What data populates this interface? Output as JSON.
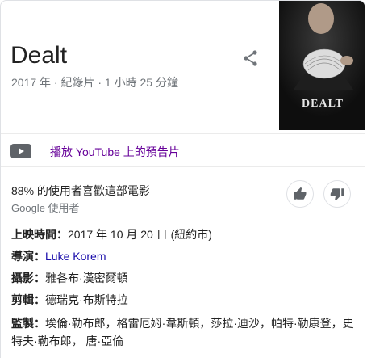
{
  "header": {
    "title": "Dealt",
    "subtitle": "2017 年 · 紀錄片 · 1 小時 25 分鐘",
    "share_icon": "share-icon"
  },
  "poster": {
    "title": "DEALT"
  },
  "trailer": {
    "icon": "youtube-play-icon",
    "link": "播放 YouTube 上的預告片"
  },
  "rating": {
    "text": "88% 的使用者喜歡這部電影",
    "source": "Google 使用者",
    "like_icon": "thumbs-up-icon",
    "dislike_icon": "thumbs-down-icon"
  },
  "facts": {
    "release_label": "上映時間：",
    "release_value": "2017 年 10 月 20 日 (紐約市)",
    "director_label": "導演：",
    "director_value": "Luke Korem",
    "cinematography_label": "攝影：",
    "cinematography_value": "雅各布·漢密爾頓",
    "editor_label": "剪輯：",
    "editor_value": "德瑞克·布斯特拉",
    "producers_label": "監製：",
    "producers_value": "埃倫·勒布郎，格雷厄姆·韋斯頓，莎拉·迪沙，帕特·勒康登，史特夫·勒布郎， 唐·亞倫"
  },
  "colors": {
    "link_visited": "#660099",
    "link": "#1a0dab",
    "muted": "#70757a",
    "divider": "#ebebeb"
  }
}
